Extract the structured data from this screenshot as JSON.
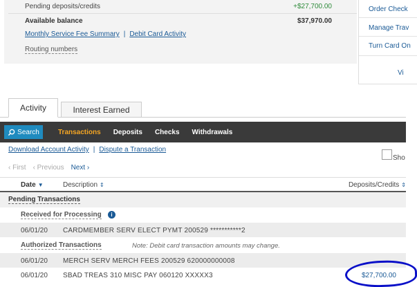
{
  "summary": {
    "pending_label": "Pending deposits/credits",
    "pending_value": "+$27,700.00",
    "available_label": "Available balance",
    "available_value": "$37,970.00",
    "monthly_fee_link": "Monthly Service Fee Summary",
    "debit_card_link": "Debit Card Activity",
    "routing_link": "Routing numbers"
  },
  "side_panel": {
    "order_checks": "Order Check",
    "manage_travel": "Manage Trav",
    "turn_card_on": "Turn Card On",
    "view": "Vi"
  },
  "tabs": {
    "activity": "Activity",
    "interest": "Interest Earned"
  },
  "toolbar": {
    "search": "Search",
    "transactions": "Transactions",
    "deposits": "Deposits",
    "checks": "Checks",
    "withdrawals": "Withdrawals"
  },
  "links": {
    "download": "Download Account Activity",
    "dispute": "Dispute a Transaction",
    "show": "Sho"
  },
  "pager": {
    "first": "First",
    "previous": "Previous",
    "next": "Next"
  },
  "table": {
    "col_date": "Date",
    "col_desc": "Description",
    "col_amount": "Deposits/Credits",
    "pending_header": "Pending Transactions",
    "received_header": "Received for Processing",
    "authorized_header": "Authorized Transactions",
    "authorized_note": "Note: Debit card transaction amounts may change.",
    "rows": [
      {
        "date": "06/01/20",
        "desc": "CARDMEMBER SERV ELECT PYMT 200529 ***********2",
        "amount": ""
      },
      {
        "date": "06/01/20",
        "desc": "MERCH SERV MERCH FEES 200529 620000000008",
        "amount": ""
      },
      {
        "date": "06/01/20",
        "desc": "SBAD TREAS 310 MISC PAY 060120 XXXXX3",
        "amount": "$27,700.00"
      }
    ]
  },
  "colors": {
    "accent": "#1f8bbf",
    "toolbar": "#3a3a3a",
    "active_tab": "#f5a623",
    "credit_green": "#2e8b3a",
    "annotation": "#0a10c8"
  }
}
